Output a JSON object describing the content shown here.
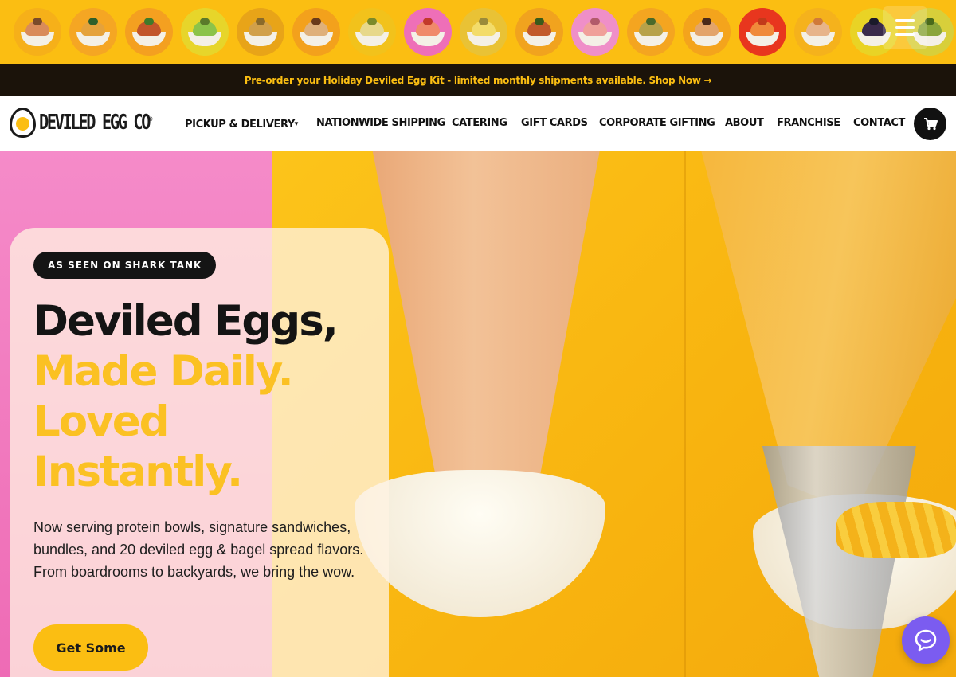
{
  "carousel": {
    "eggs": [
      {
        "bg": "#f6b019",
        "filling": "#d98b5a",
        "garnish": "#7a4a2a"
      },
      {
        "bg": "#f5a623",
        "filling": "#e5a23b",
        "garnish": "#2f5f2a"
      },
      {
        "bg": "#f4a020",
        "filling": "#c2552a",
        "garnish": "#3f7a2a"
      },
      {
        "bg": "#e7d52a",
        "filling": "#8cc34a",
        "garnish": "#5a7a2a"
      },
      {
        "bg": "#e8a418",
        "filling": "#d1a04a",
        "garnish": "#8a6a2a"
      },
      {
        "bg": "#f3a11c",
        "filling": "#dfb07a",
        "garnish": "#6a3a1a"
      },
      {
        "bg": "#f2c21b",
        "filling": "#e7d88a",
        "garnish": "#7a8a2a"
      },
      {
        "bg": "#ee6fb8",
        "filling": "#f08a6a",
        "garnish": "#c23a2a"
      },
      {
        "bg": "#e9c235",
        "filling": "#f3dc6a",
        "garnish": "#9a8a3a"
      },
      {
        "bg": "#f1a31e",
        "filling": "#c25a2a",
        "garnish": "#3a5a1a"
      },
      {
        "bg": "#ef8fc8",
        "filling": "#f0a09a",
        "garnish": "#b25a6a"
      },
      {
        "bg": "#f4a520",
        "filling": "#b7a24a",
        "garnish": "#4a6a2a"
      },
      {
        "bg": "#f4a41c",
        "filling": "#e3a46a",
        "garnish": "#4a2a1a"
      },
      {
        "bg": "#e8361e",
        "filling": "#f08a3a",
        "garnish": "#c23a1a"
      },
      {
        "bg": "#f5b21c",
        "filling": "#e7b48a",
        "garnish": "#d07a3a"
      },
      {
        "bg": "#e9d325",
        "filling": "#3a2a4a",
        "garnish": "#1a1a2a"
      },
      {
        "bg": "#d8cf3a",
        "filling": "#8aa53a",
        "garnish": "#4a6a1a"
      }
    ]
  },
  "announcement": {
    "text": "Pre-order your Holiday Deviled Egg Kit - limited monthly shipments available. Shop Now →"
  },
  "header": {
    "logo_text": "DEVILED EGG CO",
    "logo_mark": "®",
    "nav": [
      {
        "label": "PICKUP & DELIVERY",
        "has_dropdown": true
      },
      {
        "label": "NATIONWIDE SHIPPING"
      },
      {
        "label": "CATERING"
      },
      {
        "label": "GIFT CARDS"
      },
      {
        "label": "CORPORATE GIFTING"
      },
      {
        "label": "ABOUT"
      },
      {
        "label": "FRANCHISE"
      },
      {
        "label": "CONTACT"
      }
    ],
    "dropdown_caret": "▼",
    "cart_icon": "cart-icon"
  },
  "hero": {
    "badge": "AS SEEN ON SHARK TANK",
    "headline_line1": "Deviled Eggs,",
    "headline_line2": "Made Daily.",
    "headline_line3": "Loved",
    "headline_line4": "Instantly.",
    "description": "Now serving protein bowls, signature sandwiches, bundles, and 20 deviled egg & bagel spread flavors. From boardrooms to backyards, we bring the wow.",
    "cta_label": "Get Some"
  },
  "colors": {
    "brand_yellow": "#FBBE12",
    "hero_pink": "#F07FC0",
    "dark": "#141414",
    "chat_purple": "#7B5CF0"
  }
}
